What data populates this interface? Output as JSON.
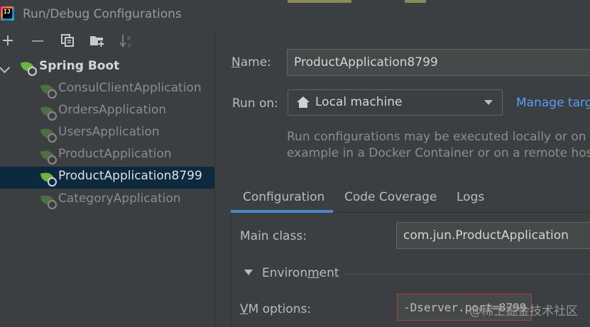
{
  "window": {
    "logo_text": "IJ",
    "title": "Run/Debug Configurations"
  },
  "toolbar": {
    "add_icon": "plus-icon",
    "remove_icon": "minus-icon",
    "copy_icon": "copy-icon",
    "new_folder_icon": "folder-add-icon",
    "sort_icon": "sort-alphabetically-icon",
    "add_glyph": "+",
    "remove_glyph": "—"
  },
  "tree": {
    "group_label": "Spring Boot",
    "items": [
      {
        "label": "ConsulClientApplication",
        "selected": false
      },
      {
        "label": "OrdersApplication",
        "selected": false
      },
      {
        "label": "UsersApplication",
        "selected": false
      },
      {
        "label": "ProductApplication",
        "selected": false
      },
      {
        "label": "ProductApplication8799",
        "selected": true
      },
      {
        "label": "CategoryApplication",
        "selected": false
      }
    ]
  },
  "form": {
    "name_label_prefix": "N",
    "name_label_rest": "ame:",
    "name_value": "ProductApplication8799",
    "run_on_label": "Run on:",
    "run_on_value": "Local machine",
    "manage_link": "Manage targ",
    "hint_line1": "Run configurations may be executed locally or on a t",
    "hint_line2": "example in a Docker Container or on a remote host u"
  },
  "tabs": [
    {
      "label": "Configuration",
      "active": true
    },
    {
      "label": "Code Coverage",
      "active": false
    },
    {
      "label": "Logs",
      "active": false
    }
  ],
  "configuration": {
    "main_class_label": "Main class:",
    "main_class_value": "com.jun.ProductApplication",
    "environment_label_pre": "Environ",
    "environment_label_u": "m",
    "environment_label_post": "ent",
    "vm_label_u": "V",
    "vm_label_rest": "M options:",
    "vm_value": "-Dserver.port=8799"
  },
  "watermark": "@稀土掘金技术社区",
  "colors": {
    "background": "#3c3f41",
    "selection": "#0d293e",
    "link": "#589df6",
    "tab_underline": "#4a88c7",
    "spring_green": "#6db33f",
    "highlight_border": "#b33b3b"
  }
}
